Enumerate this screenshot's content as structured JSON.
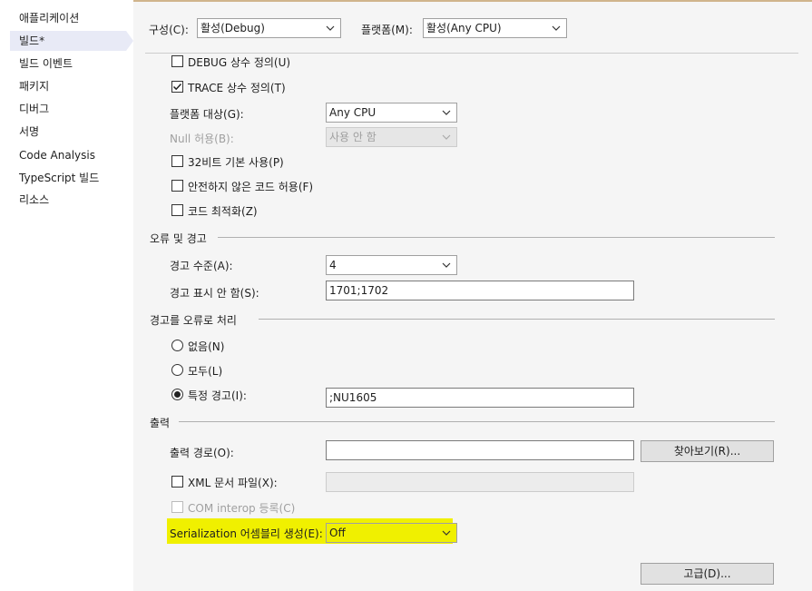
{
  "sidebar": {
    "items": [
      {
        "label": "애플리케이션"
      },
      {
        "label": "빌드*"
      },
      {
        "label": "빌드 이벤트"
      },
      {
        "label": "패키지"
      },
      {
        "label": "디버그"
      },
      {
        "label": "서명"
      },
      {
        "label": "Code Analysis"
      },
      {
        "label": "TypeScript 빌드"
      },
      {
        "label": "리소스"
      }
    ]
  },
  "toolbar": {
    "configuration_label": "구성(C):",
    "configuration_value": "활성(Debug)",
    "platform_label": "플랫폼(M):",
    "platform_value": "활성(Any CPU)"
  },
  "general": {
    "debug_const_label": "DEBUG 상수 정의(U)",
    "trace_const_label": "TRACE 상수 정의(T)",
    "trace_checked": true,
    "platform_target_label": "플랫폼 대상(G):",
    "platform_target_value": "Any CPU",
    "nullable_label": "Null 허용(B):",
    "nullable_value": "사용 안 함",
    "prefer32_label": "32비트 기본 사용(P)",
    "unsafe_label": "안전하지 않은 코드 허용(F)",
    "optimize_label": "코드 최적화(Z)"
  },
  "errors": {
    "section_title": "오류 및 경고",
    "warning_level_label": "경고 수준(A):",
    "warning_level_value": "4",
    "suppress_label": "경고 표시 안 함(S):",
    "suppress_value": "1701;1702"
  },
  "treat_warnings": {
    "section_title": "경고를 오류로 처리",
    "none_label": "없음(N)",
    "all_label": "모두(L)",
    "specific_label": "특정 경고(I):",
    "specific_value": ";NU1605",
    "selected": "specific"
  },
  "output": {
    "section_title": "출력",
    "path_label": "출력 경로(O):",
    "path_value": "",
    "browse_label": "찾아보기(R)...",
    "xml_doc_label": "XML 문서 파일(X):",
    "xml_doc_value": "",
    "com_interop_label": "COM interop 등록(C)",
    "serialization_label": "Serialization 어셈블리 생성(E):",
    "serialization_value": "Off",
    "highlight_color": "#f0f000",
    "advanced_label": "고급(D)..."
  }
}
